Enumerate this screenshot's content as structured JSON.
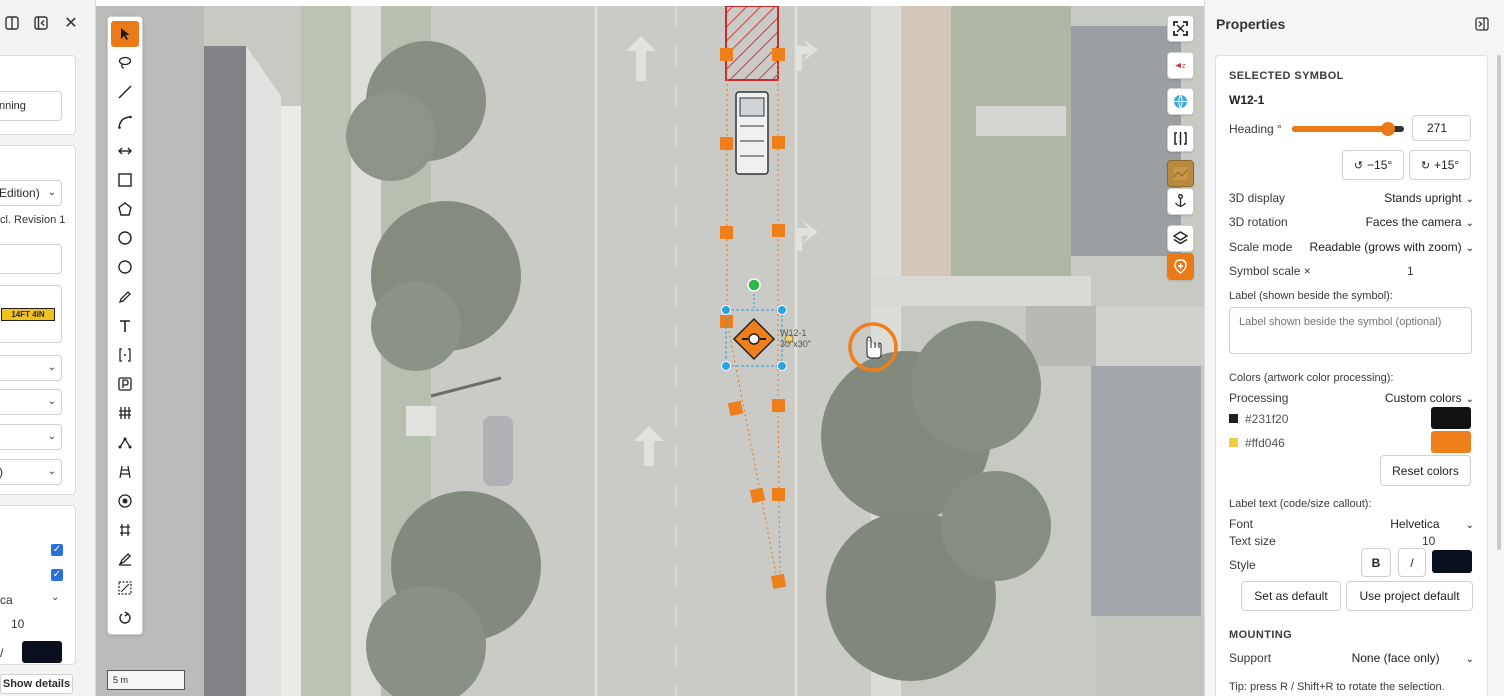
{
  "left_panel": {
    "partial_button": "nning",
    "edition_select": "Edition)",
    "revision_text": "cl. Revision 1",
    "sign_preview_text": "14FT 4IN",
    "font_partial": "ca",
    "text_size_partial": "10",
    "style_partial": "/",
    "show_details": "Show details"
  },
  "scale_bar": "5 m",
  "map": {
    "symbol_label_line1": "W12-1",
    "symbol_label_line2": "30\"x30\""
  },
  "properties": {
    "title": "Properties",
    "selected_symbol_header": "SELECTED SYMBOL",
    "symbol_code": "W12-1",
    "heading_label": "Heading °",
    "heading_value": "271",
    "heading_fraction": 0.86,
    "rotate_left": "−15°",
    "rotate_right": "+15°",
    "display_3d_label": "3D display",
    "display_3d_value": "Stands upright",
    "rotation_3d_label": "3D rotation",
    "rotation_3d_value": "Faces the camera",
    "scale_mode_label": "Scale mode",
    "scale_mode_value": "Readable (grows with zoom)",
    "symbol_scale_label": "Symbol scale ×",
    "symbol_scale_value": "1",
    "label_field_label": "Label (shown beside the symbol):",
    "label_placeholder": "Label shown beside the symbol (optional)",
    "colors_label": "Colors (artwork color processing):",
    "processing_label": "Processing",
    "processing_value": "Custom colors",
    "color1_hex": "#231f20",
    "color1_swatch": "#111111",
    "color2_hex": "#ffd046",
    "color2_swatch": "#ef7f1a",
    "reset_colors": "Reset colors",
    "label_text_header": "Label text (code/size callout):",
    "font_label": "Font",
    "font_value": "Helvetica",
    "text_size_label": "Text size",
    "text_size_value": "10",
    "style_label": "Style",
    "bold_btn": "B",
    "italic_btn": "/",
    "set_default": "Set as default",
    "use_project_default": "Use project default",
    "mounting_header": "MOUNTING",
    "support_label": "Support",
    "support_value": "None (face only)",
    "tip": "Tip: press R / Shift+R to rotate the selection."
  },
  "colors": {
    "accent": "#ea7a17",
    "blue_handle": "#2aa3e0",
    "green_handle": "#2db84a"
  }
}
